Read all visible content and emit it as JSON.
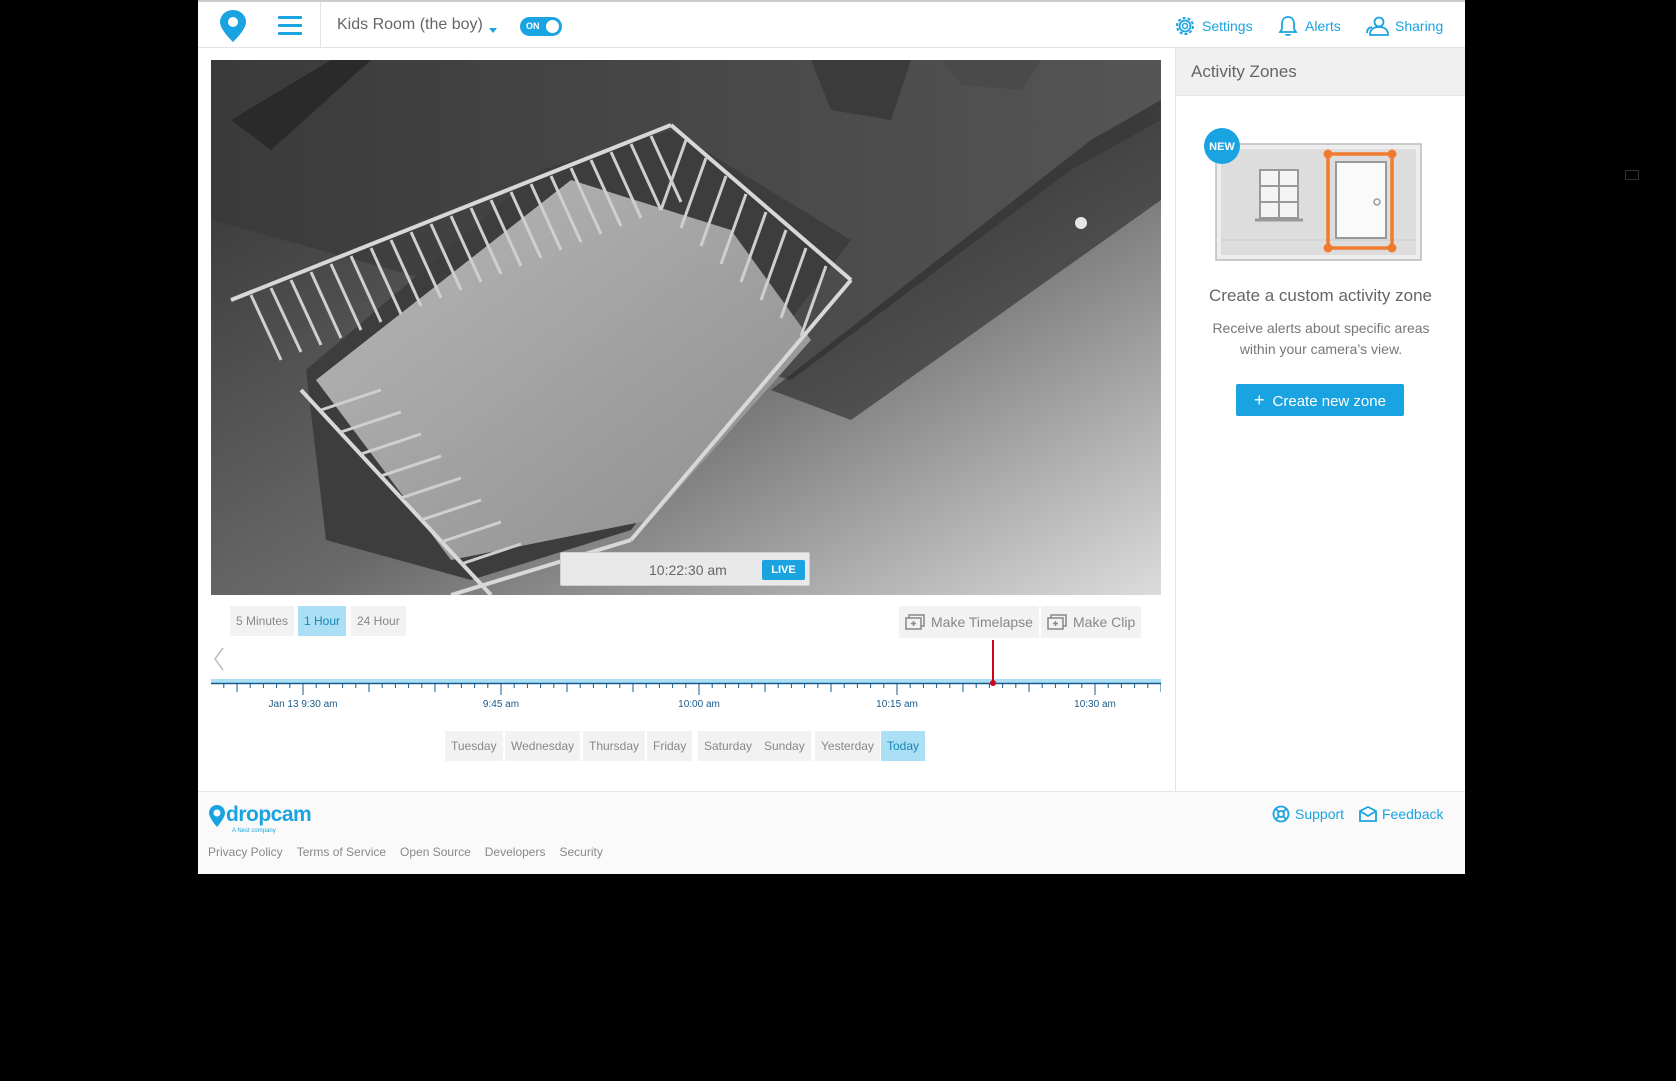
{
  "header": {
    "camera_name": "Kids Room (the boy)",
    "toggle_label": "ON",
    "nav": {
      "settings": "Settings",
      "alerts": "Alerts",
      "sharing": "Sharing"
    },
    "icons": [
      "dropcam-pin-icon",
      "hamburger-menu-icon",
      "gear-icon",
      "bell-icon",
      "users-icon"
    ]
  },
  "player": {
    "time": "10:22:30 am",
    "live_label": "LIVE"
  },
  "ranges": [
    "5 Minutes",
    "1 Hour",
    "24 Hour"
  ],
  "active_range": "1 Hour",
  "actions": {
    "timelapse": "Make Timelapse",
    "clip": "Make Clip"
  },
  "timeline": {
    "labels": [
      "Jan 13 9:30 am",
      "9:45 am",
      "10:00 am",
      "10:15 am",
      "10:30 am"
    ],
    "playhead_time": "10:22:30 am"
  },
  "days": [
    "Tuesday",
    "Wednesday",
    "Thursday",
    "Friday",
    "Saturday",
    "Sunday",
    "Yesterday",
    "Today"
  ],
  "active_day": "Today",
  "side": {
    "title": "Activity Zones",
    "badge": "NEW",
    "heading": "Create a custom activity zone",
    "description": "Receive alerts about specific areas within your camera’s view.",
    "button": "Create new zone",
    "button_icon": "+"
  },
  "footer": {
    "brand": "dropcam",
    "brand_sub": "A Nest company",
    "links": [
      "Privacy Policy",
      "Terms of Service",
      "Open Source",
      "Developers",
      "Security"
    ],
    "support": "Support",
    "feedback": "Feedback"
  },
  "colors": {
    "accent": "#1aa3e1",
    "playhead": "#d0021b",
    "zone": "#f07b2f"
  }
}
